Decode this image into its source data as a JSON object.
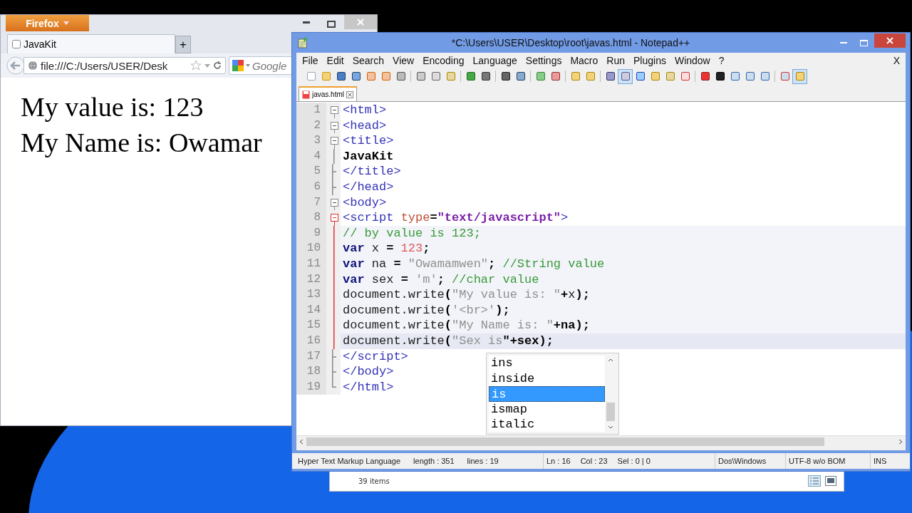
{
  "firefox": {
    "app_button": "Firefox",
    "tabs": [
      {
        "label": "JavaKit",
        "selected": true
      }
    ],
    "new_tab": "+",
    "url": "file:///C:/Users/USER/Desk",
    "search": {
      "placeholder": "Google"
    },
    "content": [
      "My value is: 123",
      "My Name is: Owamar"
    ]
  },
  "notepad": {
    "title": "*C:\\Users\\USER\\Desktop\\root\\javas.html - Notepad++",
    "menu": [
      "File",
      "Edit",
      "Search",
      "View",
      "Encoding",
      "Language",
      "Settings",
      "Macro",
      "Run",
      "Plugins",
      "Window",
      "?"
    ],
    "close_doc": "X",
    "tabs": [
      {
        "label": "javas.html",
        "selected": true,
        "modified": true
      }
    ],
    "lines": [
      {
        "number": "1",
        "fold": {
          "kind": "open",
          "active": false
        },
        "in_block": false,
        "current": false,
        "tokens": [
          {
            "kind": "tag",
            "text": "<html>"
          }
        ]
      },
      {
        "number": "2",
        "fold": {
          "kind": "open",
          "active": false
        },
        "in_block": false,
        "current": false,
        "tokens": [
          {
            "kind": "tag",
            "text": "<head>"
          }
        ]
      },
      {
        "number": "3",
        "fold": {
          "kind": "open",
          "active": false
        },
        "in_block": false,
        "current": false,
        "tokens": [
          {
            "kind": "tag",
            "text": "<title>"
          }
        ]
      },
      {
        "number": "4",
        "fold": {
          "kind": "inner",
          "active": false
        },
        "in_block": false,
        "current": false,
        "tokens": [
          {
            "kind": "bold",
            "text": "JavaKit"
          }
        ]
      },
      {
        "number": "5",
        "fold": {
          "kind": "close",
          "active": false
        },
        "in_block": false,
        "current": false,
        "tokens": [
          {
            "kind": "tag",
            "text": "</title>"
          }
        ]
      },
      {
        "number": "6",
        "fold": {
          "kind": "close",
          "active": false
        },
        "in_block": false,
        "current": false,
        "tokens": [
          {
            "kind": "tag",
            "text": "</head>"
          }
        ]
      },
      {
        "number": "7",
        "fold": {
          "kind": "open",
          "active": false
        },
        "in_block": false,
        "current": false,
        "tokens": [
          {
            "kind": "tag",
            "text": "<body>"
          }
        ]
      },
      {
        "number": "8",
        "fold": {
          "kind": "open",
          "active": true
        },
        "in_block": false,
        "current": false,
        "tokens": [
          {
            "kind": "tag",
            "text": "<script "
          },
          {
            "kind": "attr",
            "text": "type"
          },
          {
            "kind": "op",
            "text": "="
          },
          {
            "kind": "attrval",
            "text": "\"text/javascript\""
          },
          {
            "kind": "tag",
            "text": ">"
          }
        ]
      },
      {
        "number": "9",
        "fold": {
          "kind": "inner",
          "active": true
        },
        "in_block": true,
        "current": false,
        "tokens": [
          {
            "kind": "cmt",
            "text": "// by value is 123;"
          }
        ]
      },
      {
        "number": "10",
        "fold": {
          "kind": "inner",
          "active": true
        },
        "in_block": true,
        "current": false,
        "tokens": [
          {
            "kind": "kw",
            "text": "var"
          },
          {
            "kind": "id",
            "text": " x "
          },
          {
            "kind": "op",
            "text": "="
          },
          {
            "kind": "num",
            "text": " 123"
          },
          {
            "kind": "op",
            "text": ";"
          }
        ]
      },
      {
        "number": "11",
        "fold": {
          "kind": "inner",
          "active": true
        },
        "in_block": true,
        "current": false,
        "tokens": [
          {
            "kind": "kw",
            "text": "var"
          },
          {
            "kind": "id",
            "text": " na "
          },
          {
            "kind": "op",
            "text": "="
          },
          {
            "kind": "str",
            "text": " \"Owamamwen\""
          },
          {
            "kind": "op",
            "text": ";"
          },
          {
            "kind": "cmt",
            "text": " //String value"
          }
        ]
      },
      {
        "number": "12",
        "fold": {
          "kind": "inner",
          "active": true
        },
        "in_block": true,
        "current": false,
        "tokens": [
          {
            "kind": "kw",
            "text": "var"
          },
          {
            "kind": "id",
            "text": " sex "
          },
          {
            "kind": "op",
            "text": "="
          },
          {
            "kind": "str",
            "text": " 'm'"
          },
          {
            "kind": "op",
            "text": ";"
          },
          {
            "kind": "cmt",
            "text": " //char value"
          }
        ]
      },
      {
        "number": "13",
        "fold": {
          "kind": "inner",
          "active": true
        },
        "in_block": true,
        "current": false,
        "tokens": [
          {
            "kind": "id",
            "text": "document.write"
          },
          {
            "kind": "op",
            "text": "("
          },
          {
            "kind": "str",
            "text": "\"My value is: \""
          },
          {
            "kind": "op",
            "text": "+"
          },
          {
            "kind": "id",
            "text": "x"
          },
          {
            "kind": "op",
            "text": ");"
          }
        ]
      },
      {
        "number": "14",
        "fold": {
          "kind": "inner",
          "active": true
        },
        "in_block": true,
        "current": false,
        "tokens": [
          {
            "kind": "id",
            "text": "document.write"
          },
          {
            "kind": "op",
            "text": "("
          },
          {
            "kind": "str",
            "text": "'<br>'"
          },
          {
            "kind": "op",
            "text": ");"
          }
        ]
      },
      {
        "number": "15",
        "fold": {
          "kind": "inner",
          "active": true
        },
        "in_block": true,
        "current": false,
        "tokens": [
          {
            "kind": "id",
            "text": "document.write"
          },
          {
            "kind": "op",
            "text": "("
          },
          {
            "kind": "str",
            "text": "\"My Name is: \""
          },
          {
            "kind": "op",
            "text": "+na);"
          }
        ]
      },
      {
        "number": "16",
        "fold": {
          "kind": "inner",
          "active": true
        },
        "in_block": true,
        "current": true,
        "tokens": [
          {
            "kind": "id",
            "text": "document.write"
          },
          {
            "kind": "op",
            "text": "("
          },
          {
            "kind": "str",
            "text": "\"Sex is"
          },
          {
            "kind": "op",
            "text": "\"+sex);"
          }
        ]
      },
      {
        "number": "17",
        "fold": {
          "kind": "close",
          "active": false
        },
        "in_block": false,
        "current": false,
        "tokens": [
          {
            "kind": "tag",
            "text": "</script>"
          }
        ]
      },
      {
        "number": "18",
        "fold": {
          "kind": "close",
          "active": false
        },
        "in_block": false,
        "current": false,
        "tokens": [
          {
            "kind": "tag",
            "text": "</body>"
          }
        ]
      },
      {
        "number": "19",
        "fold": {
          "kind": "last",
          "active": false
        },
        "in_block": false,
        "current": false,
        "tokens": [
          {
            "kind": "tag",
            "text": "</html>"
          }
        ]
      }
    ],
    "autocomplete": [
      {
        "label": "ins",
        "selected": false
      },
      {
        "label": "inside",
        "selected": false
      },
      {
        "label": "is",
        "selected": true
      },
      {
        "label": "ismap",
        "selected": false
      },
      {
        "label": "italic",
        "selected": false
      }
    ],
    "status": [
      [
        "Hyper Text Markup Language",
        "length : 351",
        "lines : 19"
      ],
      [
        "Ln : 16",
        "Col : 23",
        "Sel : 0 | 0"
      ],
      [
        "Dos\\Windows"
      ],
      [
        "UTF-8 w/o BOM"
      ],
      [
        "INS"
      ]
    ]
  },
  "explorer": {
    "status": "39 items"
  }
}
